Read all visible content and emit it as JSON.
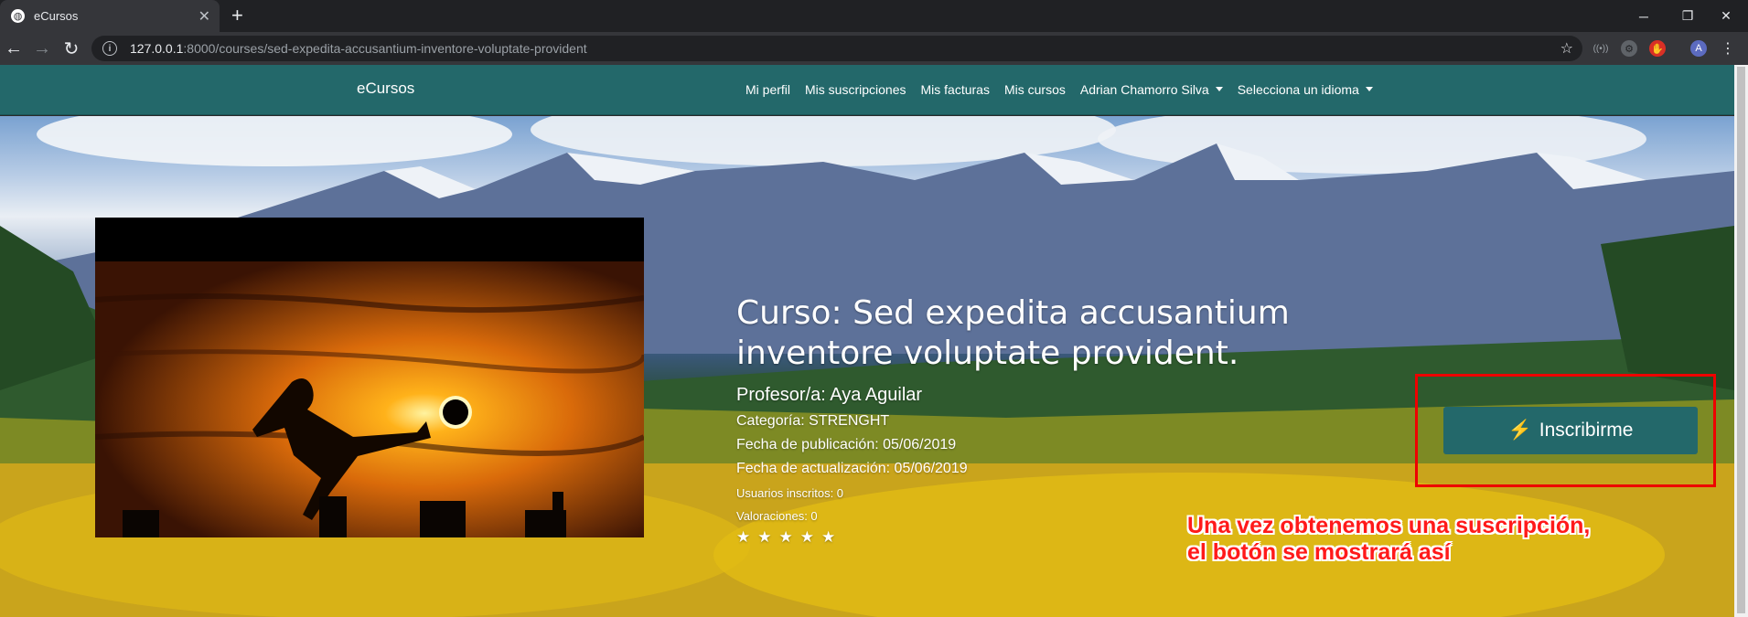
{
  "browser": {
    "tab_title": "eCursos",
    "url_host": "127.0.0.1",
    "url_rest": ":8000/courses/sed-expedita-accusantium-inventore-voluptate-provident",
    "profile_initial": "A"
  },
  "navbar": {
    "brand": "eCursos",
    "links": [
      "Mi perfil",
      "Mis suscripciones",
      "Mis facturas",
      "Mis cursos",
      "Adrian Chamorro Silva",
      "Selecciona un idioma"
    ]
  },
  "course": {
    "title": "Curso: Sed expedita accusantium inventore voluptate provident.",
    "teacher": "Profesor/a: Aya Aguilar",
    "category": "Categoría: STRENGHT",
    "published": "Fecha de publicación: 05/06/2019",
    "updated": "Fecha de actualización: 05/06/2019",
    "enrolled": "Usuarios inscritos: 0",
    "ratings": "Valoraciones: 0",
    "stars": 5,
    "subscribe_label": "Inscribirme"
  },
  "annotation": {
    "line1": "Una vez obtenemos una suscripción,",
    "line2": "el botón se mostrará así"
  },
  "colors": {
    "primary": "#23686a",
    "annotation": "#ff1a1a"
  }
}
